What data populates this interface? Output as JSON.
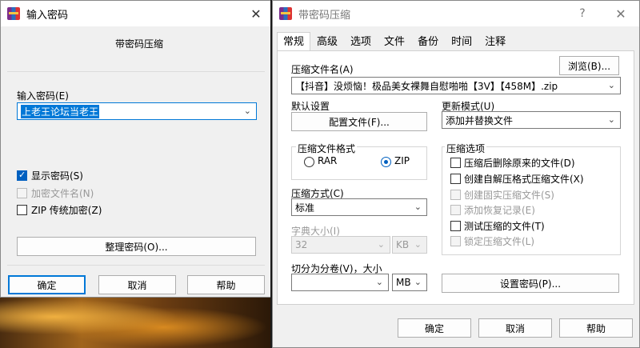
{
  "left_dialog": {
    "title": "输入密码",
    "subtitle": "带密码压缩",
    "password_label": "输入密码(E)",
    "password_value": "上老王论坛当老王",
    "show_password": "显示密码(S)",
    "encrypt_filenames": "加密文件名(N)",
    "zip_legacy": "ZIP 传统加密(Z)",
    "organize_button": "整理密码(O)...",
    "ok": "确定",
    "cancel": "取消",
    "help": "帮助"
  },
  "right_dialog": {
    "title": "带密码压缩",
    "help_glyph": "?",
    "tabs": [
      "常规",
      "高级",
      "选项",
      "文件",
      "备份",
      "时间",
      "注释"
    ],
    "archive_name_label": "压缩文件名(A)",
    "archive_name_value": "【抖音】没烦恼！极品美女裸舞自慰啪啪【3V】【458M】.zip",
    "browse": "浏览(B)...",
    "default_settings_label": "默认设置",
    "profiles_button": "配置文件(F)...",
    "update_mode_label": "更新模式(U)",
    "update_mode_value": "添加并替换文件",
    "format_group": "压缩文件格式",
    "format_rar": "RAR",
    "format_zip": "ZIP",
    "method_label": "压缩方式(C)",
    "method_value": "标准",
    "dict_label": "字典大小(I)",
    "dict_value": "32",
    "dict_unit": "KB",
    "split_label": "切分为分卷(V)，大小",
    "split_value": "",
    "split_unit": "MB",
    "options_group": "压缩选项",
    "options": [
      {
        "label": "压缩后删除原来的文件(D)",
        "enabled": true
      },
      {
        "label": "创建自解压格式压缩文件(X)",
        "enabled": true
      },
      {
        "label": "创建固实压缩文件(S)",
        "enabled": false
      },
      {
        "label": "添加恢复记录(E)",
        "enabled": false
      },
      {
        "label": "测试压缩的文件(T)",
        "enabled": true
      },
      {
        "label": "锁定压缩文件(L)",
        "enabled": false
      }
    ],
    "set_password": "设置密码(P)...",
    "ok": "确定",
    "cancel": "取消",
    "help": "帮助"
  }
}
